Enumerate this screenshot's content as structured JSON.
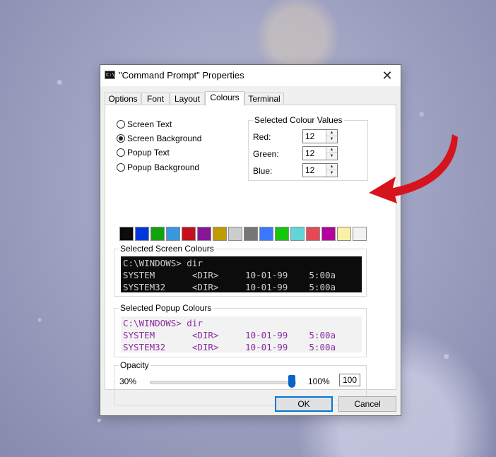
{
  "window": {
    "icon_text": "C:\\",
    "title": "\"Command Prompt\" Properties",
    "close_glyph": "✕"
  },
  "tabs": [
    {
      "label": "Options"
    },
    {
      "label": "Font"
    },
    {
      "label": "Layout"
    },
    {
      "label": "Colours",
      "active": true
    },
    {
      "label": "Terminal"
    }
  ],
  "colour_targets": [
    {
      "label": "Screen Text",
      "checked": false
    },
    {
      "label": "Screen Background",
      "checked": true
    },
    {
      "label": "Popup Text",
      "checked": false
    },
    {
      "label": "Popup Background",
      "checked": false
    }
  ],
  "selected_values": {
    "title": "Selected Colour Values",
    "red_label": "Red:",
    "red": "12",
    "green_label": "Green:",
    "green": "12",
    "blue_label": "Blue:",
    "blue": "12"
  },
  "palette": [
    "#0c0c0c",
    "#0037da",
    "#13a10e",
    "#3a96dd",
    "#c50f1f",
    "#881798",
    "#c19c00",
    "#cccccc",
    "#767676",
    "#3b78ff",
    "#16c60c",
    "#61d6d6",
    "#e74856",
    "#b4009e",
    "#f9f1a5",
    "#f2f2f2"
  ],
  "palette_selected": 0,
  "screen_preview": {
    "title": "Selected Screen Colours",
    "lines": [
      "C:\\WINDOWS> dir",
      "SYSTEM       <DIR>     10-01-99    5:00a",
      "SYSTEM32     <DIR>     10-01-99    5:00a"
    ]
  },
  "popup_preview": {
    "title": "Selected Popup Colours",
    "lines": [
      "C:\\WINDOWS> dir",
      "SYSTEM       <DIR>     10-01-99    5:00a",
      "SYSTEM32     <DIR>     10-01-99    5:00a"
    ]
  },
  "opacity": {
    "title": "Opacity",
    "min_label": "30%",
    "max_label": "100%",
    "value": "100"
  },
  "buttons": {
    "ok": "OK",
    "cancel": "Cancel"
  },
  "colors": {
    "accent": "#0078d7",
    "arrow": "#d6141d"
  }
}
